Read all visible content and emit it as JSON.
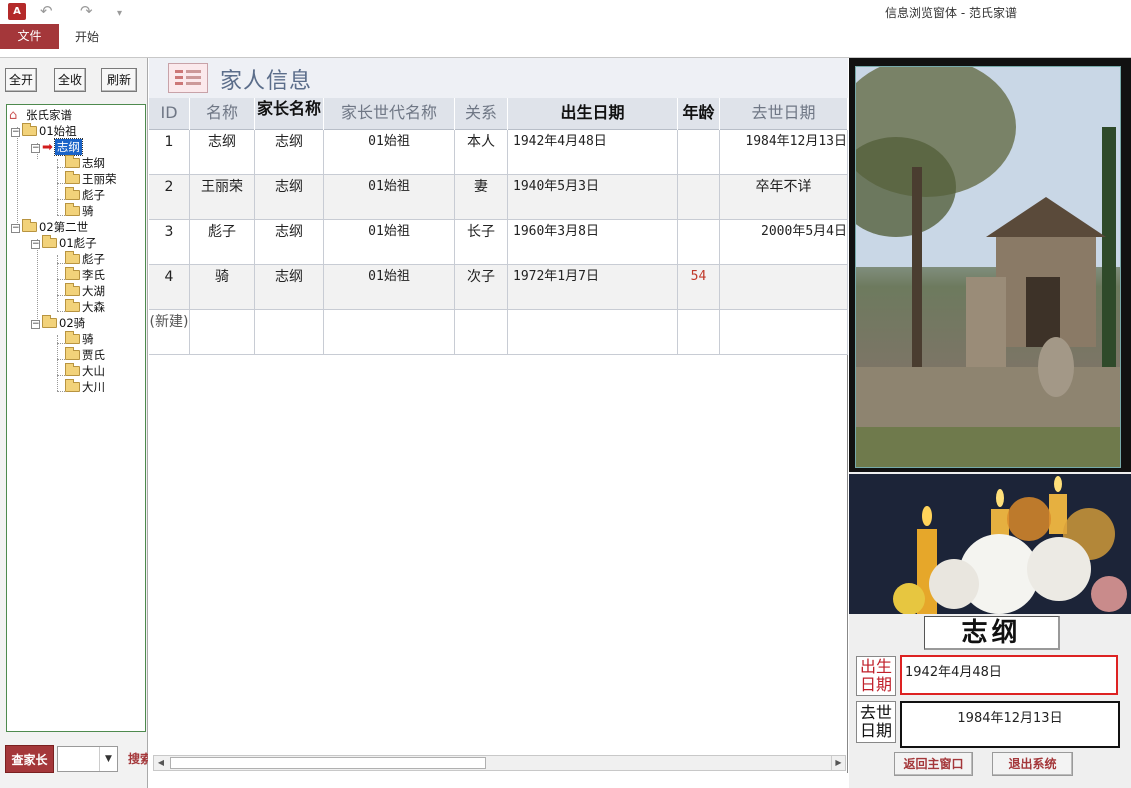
{
  "titlebar": {
    "app_icon": "A",
    "undo_icon": "undo-icon",
    "redo_icon": "redo-icon",
    "title": "信息浏览窗体 - 范氏家谱"
  },
  "ribbon": {
    "tabs": [
      {
        "label": "文件"
      },
      {
        "label": "开始"
      }
    ]
  },
  "left": {
    "buttons": {
      "expand": "全开",
      "collapse": "全收",
      "refresh": "刷新"
    },
    "tree": {
      "root": "张氏家谱",
      "nodes": [
        "01始祖",
        "志纲",
        "志纲",
        "王丽荣",
        "彪子",
        "骑",
        "02第二世",
        "01彪子",
        "彪子",
        "李氏",
        "大湖",
        "大森",
        "02骑",
        "骑",
        "贾氏",
        "大山",
        "大川"
      ]
    },
    "find_head": "查家长",
    "combo_value": "",
    "search": "搜索"
  },
  "form": {
    "title": "家人信息",
    "columns": [
      "ID",
      "名称",
      "家长名称",
      "家长世代名称",
      "关系",
      "出生日期",
      "年龄",
      "去世日期"
    ],
    "rows": [
      {
        "id": "1",
        "name": "志纲",
        "head": "志纲",
        "gen": "01始祖",
        "rel": "本人",
        "birth": "1942年4月48日",
        "age": "",
        "death": "1984年12月13日"
      },
      {
        "id": "2",
        "name": "王丽荣",
        "head": "志纲",
        "gen": "01始祖",
        "rel": "妻",
        "birth": "1940年5月3日",
        "age": "",
        "death": "卒年不详"
      },
      {
        "id": "3",
        "name": "彪子",
        "head": "志纲",
        "gen": "01始祖",
        "rel": "长子",
        "birth": "1960年3月8日",
        "age": "",
        "death": "2000年5月4日"
      },
      {
        "id": "4",
        "name": "骑",
        "head": "志纲",
        "gen": "01始祖",
        "rel": "次子",
        "birth": "1972年1月7日",
        "age": "54",
        "death": ""
      }
    ],
    "new_row": "(新建)"
  },
  "right": {
    "name": "志纲",
    "birth_label": "出生日期",
    "birth_value": "1942年4月48日",
    "death_label": "去世日期",
    "death_value": "1984年12月13日",
    "back_button": "返回主窗口",
    "exit_button": "退出系统"
  },
  "colors": {
    "accent": "#a4373a",
    "selection": "#1b64c8",
    "header_bg": "#dfe3ea"
  }
}
